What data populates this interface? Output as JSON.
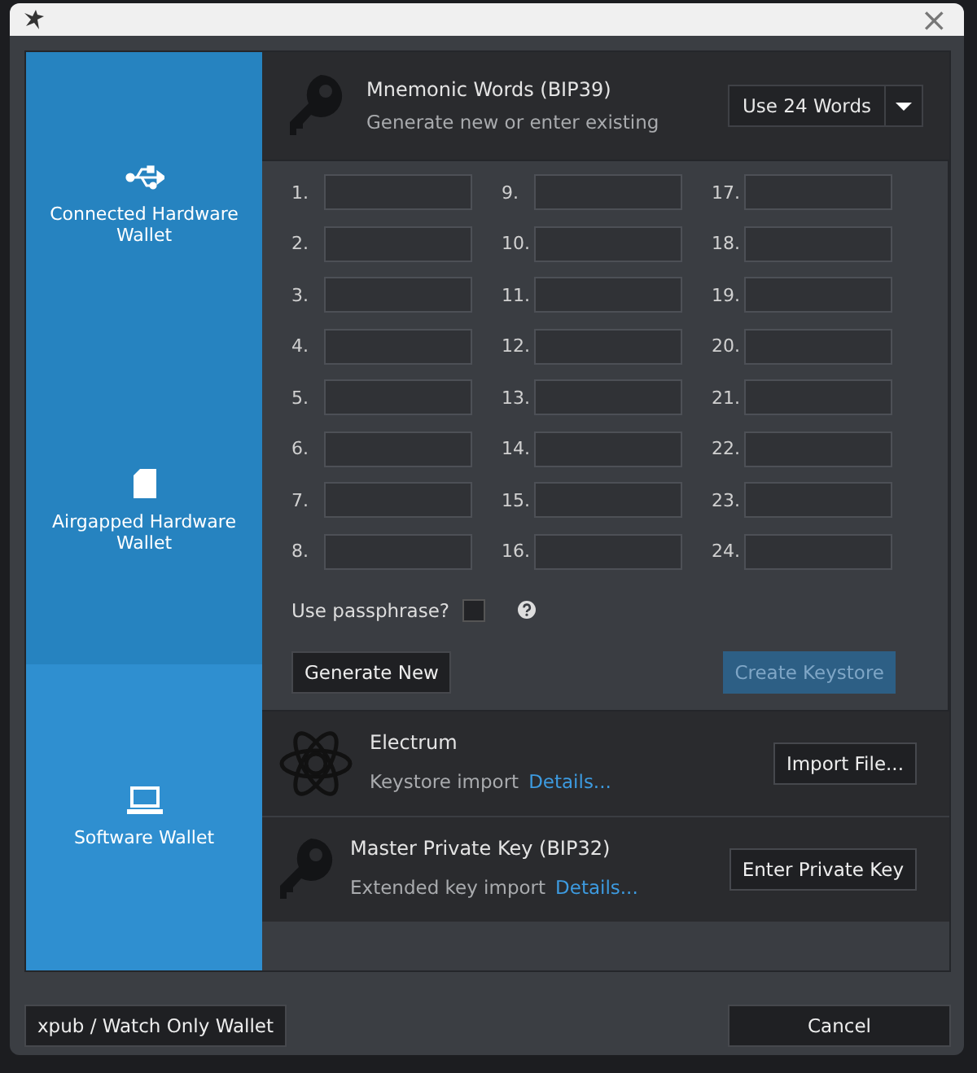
{
  "window": {
    "close": "×"
  },
  "sidebar": {
    "items": [
      {
        "label": "Connected Hardware Wallet",
        "kind": "usb",
        "selected": false
      },
      {
        "label": "Airgapped Hardware Wallet",
        "kind": "card",
        "selected": false
      },
      {
        "label": "Software Wallet",
        "kind": "laptop",
        "selected": true
      }
    ]
  },
  "mnemonic": {
    "title": "Mnemonic Words (BIP39)",
    "subtitle": "Generate new or enter existing",
    "word_count": "Use 24 Words",
    "words": [
      {
        "number": "1."
      },
      {
        "number": "2."
      },
      {
        "number": "3."
      },
      {
        "number": "4."
      },
      {
        "number": "5."
      },
      {
        "number": "6."
      },
      {
        "number": "7."
      },
      {
        "number": "8."
      },
      {
        "number": "9."
      },
      {
        "number": "10."
      },
      {
        "number": "11."
      },
      {
        "number": "12."
      },
      {
        "number": "13."
      },
      {
        "number": "14."
      },
      {
        "number": "15."
      },
      {
        "number": "16."
      },
      {
        "number": "17."
      },
      {
        "number": "18."
      },
      {
        "number": "19."
      },
      {
        "number": "20."
      },
      {
        "number": "21."
      },
      {
        "number": "22."
      },
      {
        "number": "23."
      },
      {
        "number": "24."
      }
    ],
    "passphrase": {
      "label": "Use passphrase?",
      "checked": false
    },
    "generate_button": "Generate New",
    "create_button": {
      "label": "Create Keystore",
      "disabled": true
    }
  },
  "importers": [
    {
      "kind": "electrum",
      "title": "Electrum",
      "subtitle": "Keystore import",
      "link": "Details...",
      "button": "Import File..."
    },
    {
      "kind": "key",
      "title": "Master Private Key (BIP32)",
      "subtitle": "Extended key import",
      "link": "Details...",
      "button": "Enter Private Key"
    }
  ],
  "footer": {
    "watch_button": "xpub / Watch Only Wallet",
    "cancel_button": "Cancel"
  }
}
